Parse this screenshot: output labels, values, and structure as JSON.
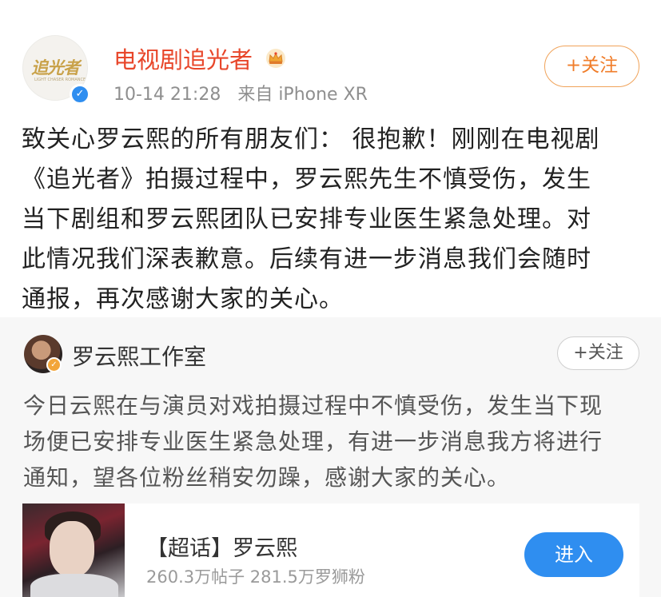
{
  "post": {
    "avatar_logo_text": "追光者",
    "avatar_logo_subtext": "LIGHT CHASER ROMANCE",
    "username": "电视剧追光者",
    "timestamp": "10-14 21:28",
    "source": "来自 iPhone XR",
    "follow_label": "+关注",
    "body_lines": [
      "致关心罗云熙的所有朋友们： 很抱歉！刚刚在电视剧",
      "《追光者》拍摄过程中，罗云熙先生不慎受伤，发生",
      "当下剧组和罗云熙团队已安排专业医生紧急处理。对",
      "此情况我们深表歉意。后续有进一步消息我们会随时",
      "通报，再次感谢大家的关心。"
    ]
  },
  "quote": {
    "username": "罗云熙工作室",
    "follow_label": "+关注",
    "body_lines": [
      "今日云熙在与演员对戏拍摄过程中不慎受伤，发生当下现",
      "场便已安排专业医生紧急处理，有进一步消息我方将进行",
      "通知，望各位粉丝稍安勿躁，感谢大家的关心。"
    ],
    "card": {
      "title": "【超话】罗云熙",
      "stats": "260.3万帖子 281.5万罗狮粉",
      "enter_label": "进入"
    }
  },
  "colors": {
    "username_red": "#e8462a",
    "follow_orange": "#f07d2a",
    "verified_blue": "#2f8ef0",
    "enter_blue": "#2f8ef0",
    "quote_bg": "#f7f7f7"
  },
  "icons": {
    "crown": "crown-icon",
    "verified": "verified-check-icon"
  }
}
